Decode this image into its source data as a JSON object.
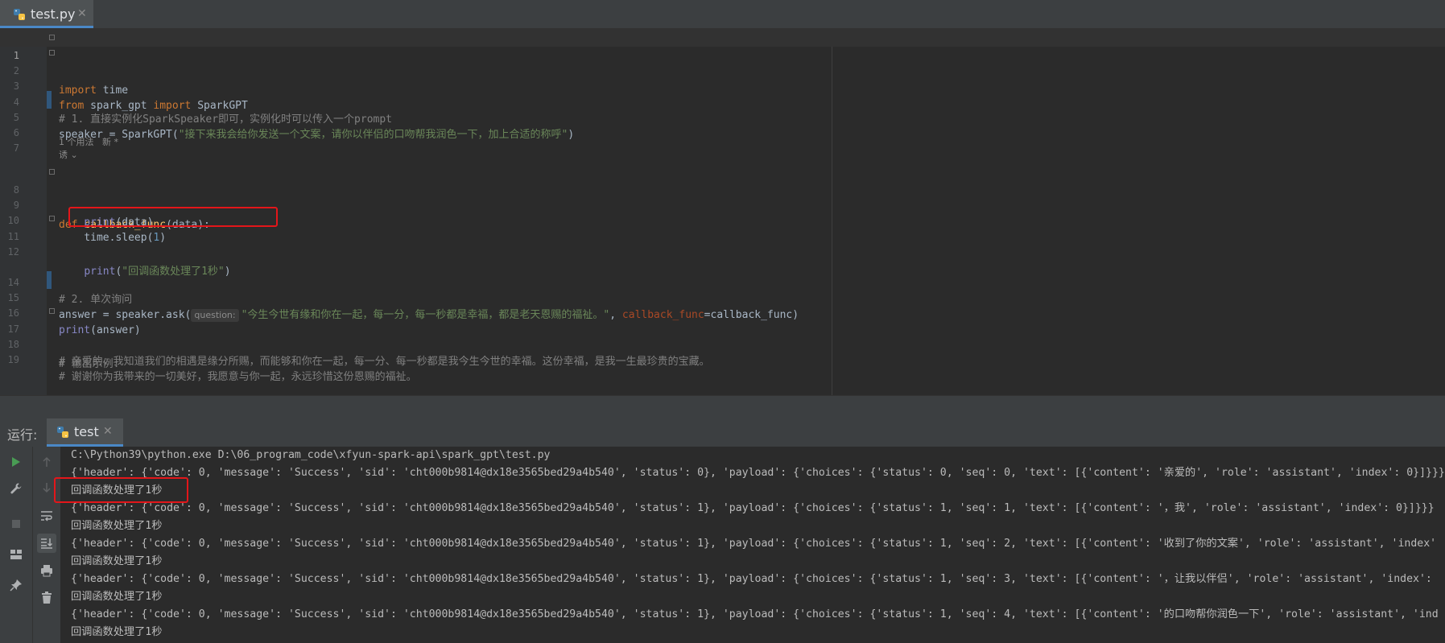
{
  "editor_tab": {
    "label": "test.py",
    "close": "✕"
  },
  "editor": {
    "line_numbers": [
      "1",
      "2",
      "3",
      "4",
      "5",
      "6",
      "7",
      "8",
      "9",
      "10",
      "11",
      "12",
      "14",
      "15",
      "16",
      "17",
      "18",
      "19"
    ],
    "line_numbers_map": {
      "l1": "1",
      "l2": "2",
      "l3": "3",
      "l4": "4",
      "l5": "5",
      "l6": "6",
      "l7": "7",
      "l8": "8",
      "l9": "9",
      "l10": "10",
      "l11": "11",
      "l12": "12",
      "l14": "14",
      "l15": "15",
      "l16": "16",
      "l17": "17",
      "l18": "18",
      "l19": "19"
    },
    "l1": {
      "kw": "import",
      "rest": " time"
    },
    "l2": {
      "kw1": "from",
      "mid": " spark_gpt ",
      "kw2": "import",
      "rest": " SparkGPT"
    },
    "l4": {
      "comment": "# 1. 直接实例化SparkSpeaker即可，实例化时可以传入一个prompt"
    },
    "l5": {
      "pre": "speaker = SparkGPT(",
      "str": "\"接下来我会给你发送一个文案，请你以伴侣的口吻帮我润色一下，加上合适的称呼\"",
      "post": ")"
    },
    "usage_hint": "1 个用法   新 *",
    "author_hint": "诱 ⌄",
    "l8": {
      "kw": "def",
      "name": " callback_func",
      "rest": "(data):"
    },
    "l9": {
      "indent": "    ",
      "bi": "print",
      "rest": "(data)"
    },
    "l10": {
      "indent": "    ",
      "pre": "time.sleep(",
      "num": "1",
      "post": ")"
    },
    "l11": {
      "indent": "    ",
      "bi": "print",
      "open": "(",
      "str": "\"回调函数处理了1秒\"",
      "close": ")"
    },
    "l14": {
      "comment": "# 2. 单次询问"
    },
    "l15": {
      "pre": "answer = speaker.ask(",
      "hint": "question:",
      "str": "\"今生今世有缘和你在一起，每一分，每一秒都是幸福，都是老天恩赐的福祉。\"",
      "comma": ", ",
      "param": "callback_func",
      "post": "=callback_func)"
    },
    "l16": {
      "bi": "print",
      "rest": "(answer)"
    },
    "l17": {
      "comment": "# 输出示例:"
    },
    "l18": {
      "comment": "# 亲爱的，我知道我们的相遇是缘分所赐，而能够和你在一起，每一分、每一秒都是我今生今世的幸福。这份幸福，是我一生最珍贵的宝藏。"
    },
    "l19": {
      "comment": "# 谢谢你为我带来的一切美好，我愿意与你一起，永远珍惜这份恩赐的福祉。"
    }
  },
  "run_panel": {
    "title": "运行:",
    "tab_label": "test",
    "tab_close": "✕",
    "console_lines": [
      "C:\\Python39\\python.exe D:\\06_program_code\\xfyun-spark-api\\spark_gpt\\test.py",
      "{'header': {'code': 0, 'message': 'Success', 'sid': 'cht000b9814@dx18e3565bed29a4b540', 'status': 0}, 'payload': {'choices': {'status': 0, 'seq': 0, 'text': [{'content': '亲爱的', 'role': 'assistant', 'index': 0}]}}}",
      "回调函数处理了1秒",
      "{'header': {'code': 0, 'message': 'Success', 'sid': 'cht000b9814@dx18e3565bed29a4b540', 'status': 1}, 'payload': {'choices': {'status': 1, 'seq': 1, 'text': [{'content': '，我', 'role': 'assistant', 'index': 0}]}}}",
      "回调函数处理了1秒",
      "{'header': {'code': 0, 'message': 'Success', 'sid': 'cht000b9814@dx18e3565bed29a4b540', 'status': 1}, 'payload': {'choices': {'status': 1, 'seq': 2, 'text': [{'content': '收到了你的文案', 'role': 'assistant', 'index'",
      "回调函数处理了1秒",
      "{'header': {'code': 0, 'message': 'Success', 'sid': 'cht000b9814@dx18e3565bed29a4b540', 'status': 1}, 'payload': {'choices': {'status': 1, 'seq': 3, 'text': [{'content': '，让我以伴侣', 'role': 'assistant', 'index':",
      "回调函数处理了1秒",
      "{'header': {'code': 0, 'message': 'Success', 'sid': 'cht000b9814@dx18e3565bed29a4b540', 'status': 1}, 'payload': {'choices': {'status': 1, 'seq': 4, 'text': [{'content': '的口吻帮你润色一下', 'role': 'assistant', 'ind",
      "回调函数处理了1秒"
    ]
  },
  "icons": {
    "python_file": "python-icon",
    "run": "play-icon",
    "settings": "wrench-icon",
    "stop": "stop-icon",
    "layout": "layout-icon",
    "pin": "pin-icon",
    "up": "arrow-up-icon",
    "down": "arrow-down-icon",
    "wrap": "soft-wrap-icon",
    "scroll_end": "scroll-to-end-icon",
    "print": "print-icon",
    "trash": "trash-icon"
  },
  "colors": {
    "accent": "#4a88c7",
    "highlight_box": "#e3161a",
    "run_green": "#499c54"
  }
}
